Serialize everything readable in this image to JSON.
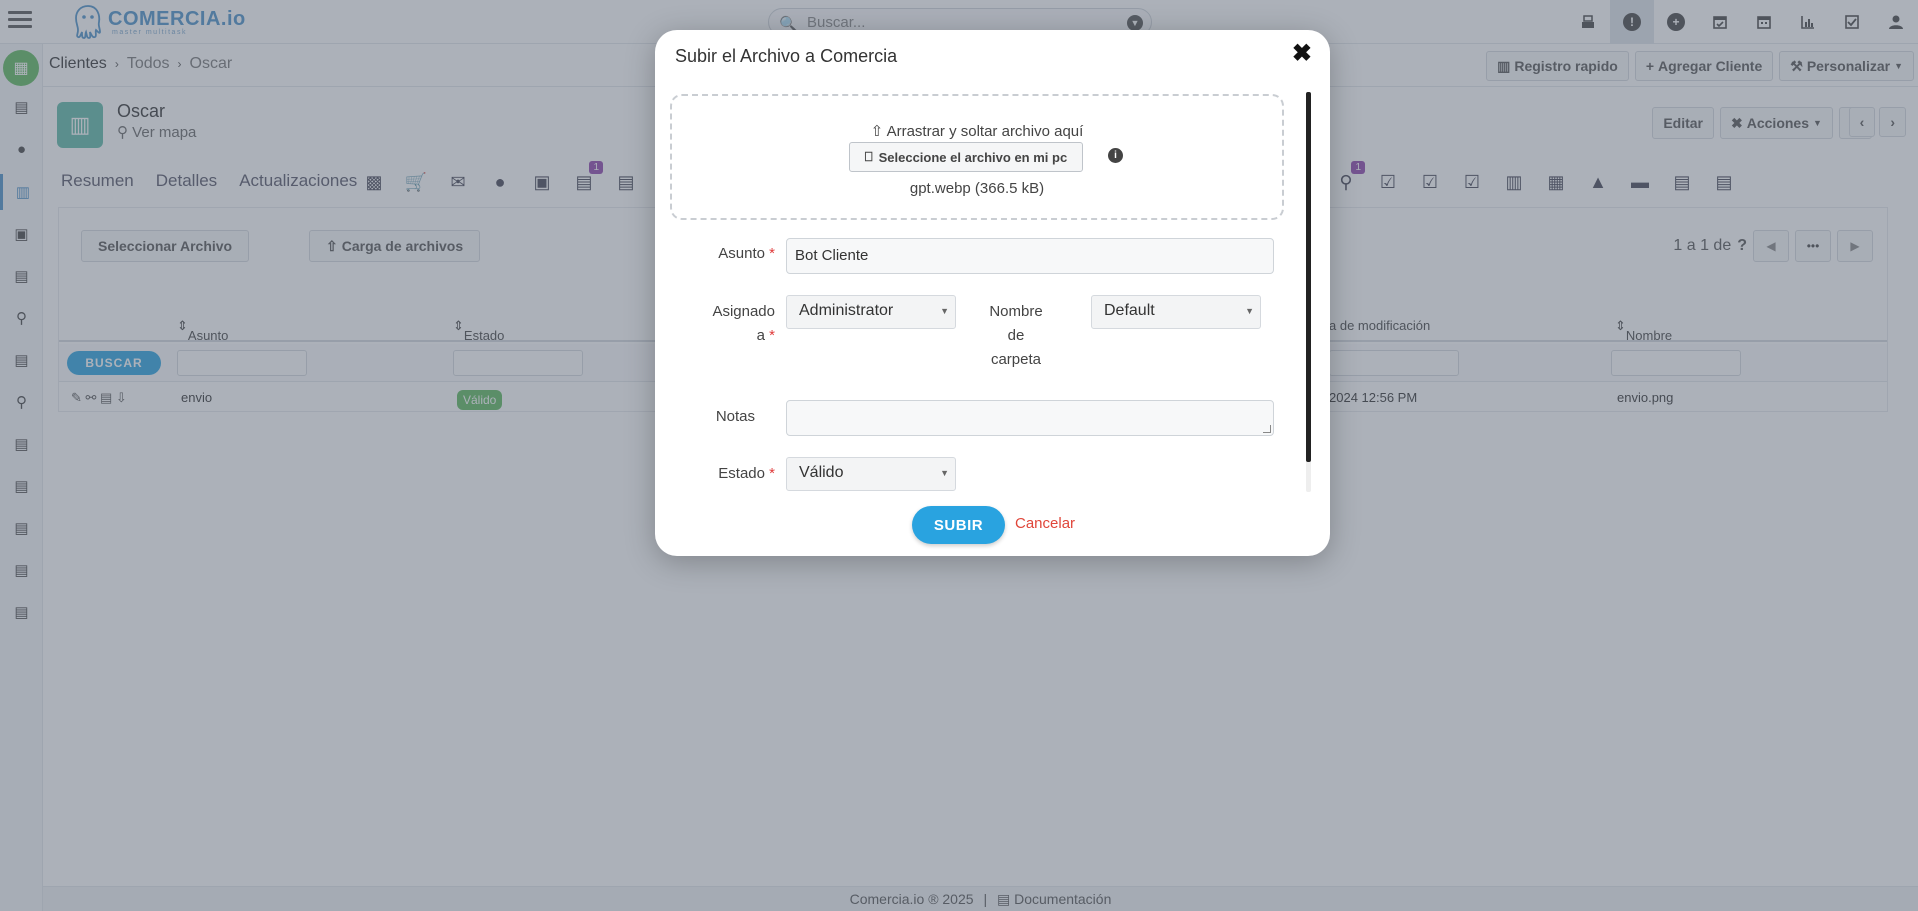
{
  "topbar": {
    "brand_name": "COMERCIA.io",
    "brand_tagline": "master multitask",
    "search_placeholder": "Buscar...",
    "icons": [
      "pos-icon",
      "alert-icon",
      "plus-circle-icon",
      "calendar-check-icon",
      "calendar-icon",
      "chart-icon",
      "checkbox-icon",
      "user-icon"
    ]
  },
  "breadcrumb": {
    "items": [
      "Clientes",
      "Todos",
      "Oscar"
    ],
    "separator": "›"
  },
  "breadcrumb_actions": {
    "registro": "Registro rapido",
    "agregar": "Agregar Cliente",
    "personalizar": "Personalizar"
  },
  "record": {
    "name": "Oscar",
    "map_link": "Ver mapa",
    "editar": "Editar",
    "acciones": "Acciones"
  },
  "tabs": [
    "Resumen",
    "Detalles",
    "Actualizaciones"
  ],
  "tab_badges": {
    "doc": "1",
    "location": "1"
  },
  "subpanel": {
    "select_file": "Seleccionar Archivo",
    "carga": "Carga de archivos",
    "pager_text": "1 a 1  de",
    "pager_help": "?",
    "columns": {
      "asunto": "Asunto",
      "estado": "Estado",
      "modificacion": "a de modificación",
      "nombre_archivo": "Nombre de archivo"
    },
    "buscar": "BUSCAR",
    "row": {
      "asunto": "envio",
      "estado": "Válido",
      "fecha": "2024 12:56 PM",
      "archivo": "envio.png"
    }
  },
  "footer": {
    "copyright": "Comercia.io ® 2025",
    "separator": "|",
    "docs": "Documentación"
  },
  "modal": {
    "title": "Subir el Archivo a Comercia",
    "drop_text": "Arrastrar y soltar archivo aquí",
    "select_button": "Seleccione el archivo en mi pc",
    "file_name": "gpt.webp (366.5 kB)",
    "asunto_label": "Asunto",
    "asunto_value": "Bot Cliente",
    "asignado_label_1": "Asignado",
    "asignado_label_2": "a",
    "asignado_value": "Administrator",
    "carpeta_label_1": "Nombre",
    "carpeta_label_2": "de",
    "carpeta_label_3": "carpeta",
    "carpeta_value": "Default",
    "notas_label": "Notas",
    "estado_label": "Estado",
    "estado_value": "Válido",
    "required_mark": "*",
    "submit": "SUBIR",
    "cancel": "Cancelar"
  },
  "colors": {
    "accent": "#29a3e0",
    "success": "#5cb85c",
    "danger": "#e0463a",
    "badge": "#8e44ad"
  }
}
